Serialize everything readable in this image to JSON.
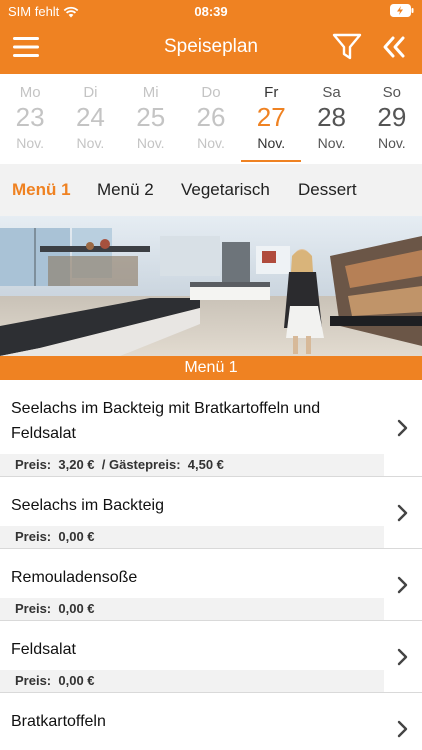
{
  "status": {
    "carrier": "SIM fehlt",
    "time": "08:39"
  },
  "nav": {
    "title": "Speiseplan"
  },
  "days": [
    {
      "weekday": "Mo",
      "day": "23",
      "month": "Nov.",
      "state": "past"
    },
    {
      "weekday": "Di",
      "day": "24",
      "month": "Nov.",
      "state": "past"
    },
    {
      "weekday": "Mi",
      "day": "25",
      "month": "Nov.",
      "state": "past"
    },
    {
      "weekday": "Do",
      "day": "26",
      "month": "Nov.",
      "state": "past"
    },
    {
      "weekday": "Fr",
      "day": "27",
      "month": "Nov.",
      "state": "selected"
    },
    {
      "weekday": "Sa",
      "day": "28",
      "month": "Nov.",
      "state": "weekend"
    },
    {
      "weekday": "So",
      "day": "29",
      "month": "Nov.",
      "state": "weekend"
    }
  ],
  "categories": [
    "Menü 1",
    "Menü 2",
    "Vegetarisch",
    "Dessert"
  ],
  "active_category": "Menü 1",
  "section_title": "Menü 1",
  "meals": [
    {
      "name": "Seelachs im Backteig mit Bratkartoffeln und Feldsalat",
      "price_label": "Preis:",
      "price": "3,20 €",
      "guest_label": "/ Gästepreis:",
      "guest_price": "4,50 €"
    },
    {
      "name": "Seelachs im Backteig",
      "price_label": "Preis:",
      "price": "0,00 €"
    },
    {
      "name": "Remouladensoße",
      "price_label": "Preis:",
      "price": "0,00 €"
    },
    {
      "name": "Feldsalat",
      "price_label": "Preis:",
      "price": "0,00 €"
    },
    {
      "name": "Bratkartoffeln"
    }
  ],
  "colors": {
    "accent": "#ef8222",
    "muted": "#c4c4c4",
    "band": "#f2f2f2"
  },
  "icons": [
    "wifi-icon",
    "battery-icon",
    "hamburger-menu-icon",
    "filter-icon",
    "double-chevron-left-icon",
    "chevron-right-icon"
  ]
}
